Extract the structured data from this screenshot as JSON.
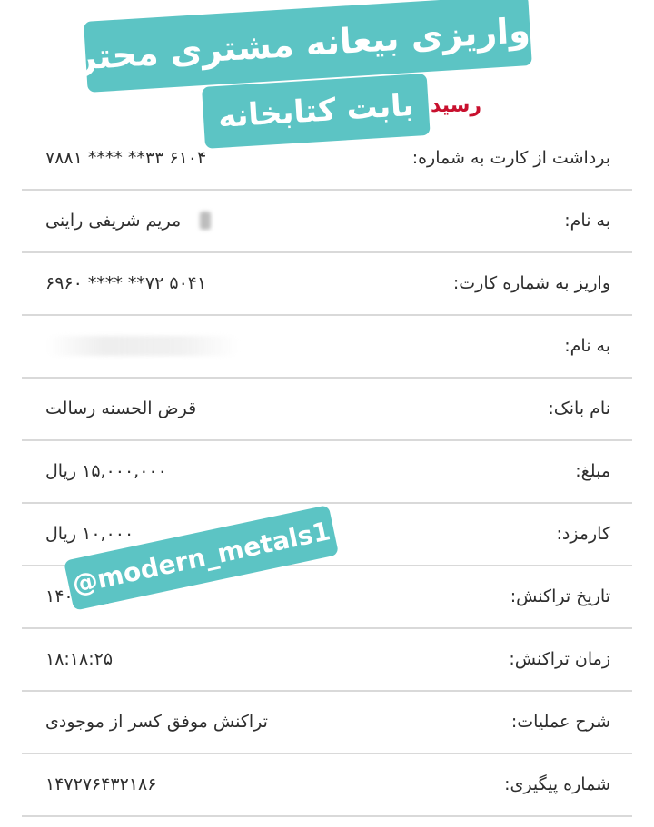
{
  "receipt": {
    "title": "رسید",
    "rows": [
      {
        "label": "برداشت از کارت به شماره:",
        "value": "۶۱۰۴ ۳۳** **** ۷۸۸۱"
      },
      {
        "label": "به نام:",
        "value": "مریم شریفی راینی"
      },
      {
        "label": "واریز به شماره کارت:",
        "value": "۵۰۴۱ ۷۲** **** ۶۹۶۰"
      },
      {
        "label": "به نام:",
        "value": ""
      },
      {
        "label": "نام بانک:",
        "value": "قرض الحسنه رسالت"
      },
      {
        "label": "مبلغ:",
        "value": "۱۵,۰۰۰,۰۰۰ ریال"
      },
      {
        "label": "کارمزد:",
        "value": "۱۰,۰۰۰ ریال"
      },
      {
        "label": "تاریخ تراکنش:",
        "value": "۱۴۰۳/۰۲/"
      },
      {
        "label": "زمان تراکنش:",
        "value": "۱۸:۱۸:۲۵"
      },
      {
        "label": "شرح عملیات:",
        "value": "تراکنش موفق کسر از موجودی"
      },
      {
        "label": "شماره پیگیری:",
        "value": "۱۴۷۲۷۶۴۳۲۱۸۶"
      }
    ]
  },
  "banner": {
    "line1": "واریزی بیعانه مشتری محترم",
    "line2": "بابت کتابخانه"
  },
  "watermark": {
    "handle": "@modern_metals1"
  },
  "colors": {
    "banner": "#5cc4c4",
    "title": "#c8102e",
    "divider": "#d9d9d9"
  }
}
